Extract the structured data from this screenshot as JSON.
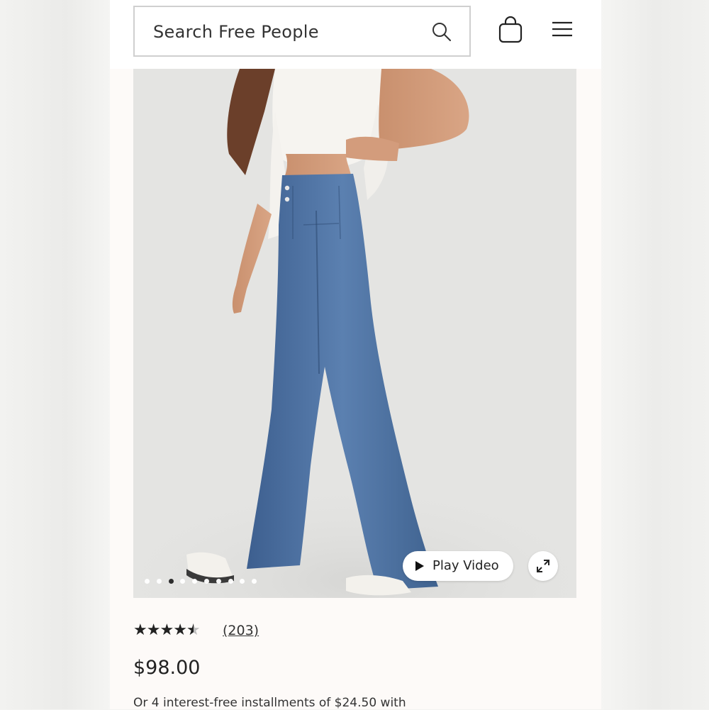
{
  "header": {
    "search_placeholder": "Search Free People",
    "icons": [
      "search-icon",
      "shopping-bag-icon",
      "hamburger-menu-icon"
    ]
  },
  "product": {
    "gallery": {
      "image_count": 10,
      "active_index": 2,
      "play_video_label": "Play Video",
      "icons": [
        "play-icon",
        "expand-icon"
      ]
    },
    "rating": {
      "stars": 4.5,
      "review_count": "(203)"
    },
    "price": "$98.00",
    "installments_text": "Or 4 interest-free installments of $24.50 with"
  },
  "colors": {
    "background": "#fdfaf8",
    "text": "#222222",
    "border": "#cfcfcf"
  }
}
